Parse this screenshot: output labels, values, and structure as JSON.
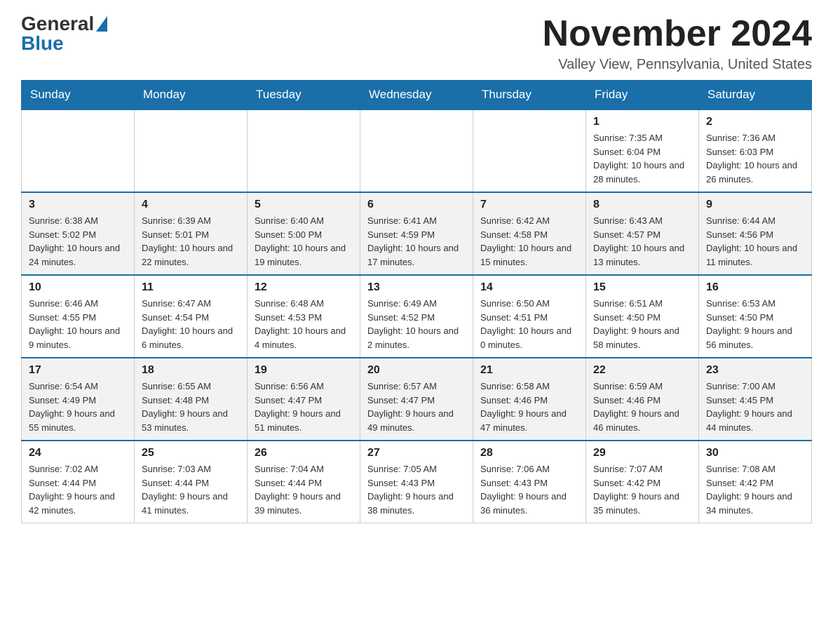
{
  "logo": {
    "general": "General",
    "blue": "Blue"
  },
  "title": "November 2024",
  "subtitle": "Valley View, Pennsylvania, United States",
  "days_of_week": [
    "Sunday",
    "Monday",
    "Tuesday",
    "Wednesday",
    "Thursday",
    "Friday",
    "Saturday"
  ],
  "weeks": [
    [
      {
        "day": "",
        "info": ""
      },
      {
        "day": "",
        "info": ""
      },
      {
        "day": "",
        "info": ""
      },
      {
        "day": "",
        "info": ""
      },
      {
        "day": "",
        "info": ""
      },
      {
        "day": "1",
        "info": "Sunrise: 7:35 AM\nSunset: 6:04 PM\nDaylight: 10 hours and 28 minutes."
      },
      {
        "day": "2",
        "info": "Sunrise: 7:36 AM\nSunset: 6:03 PM\nDaylight: 10 hours and 26 minutes."
      }
    ],
    [
      {
        "day": "3",
        "info": "Sunrise: 6:38 AM\nSunset: 5:02 PM\nDaylight: 10 hours and 24 minutes."
      },
      {
        "day": "4",
        "info": "Sunrise: 6:39 AM\nSunset: 5:01 PM\nDaylight: 10 hours and 22 minutes."
      },
      {
        "day": "5",
        "info": "Sunrise: 6:40 AM\nSunset: 5:00 PM\nDaylight: 10 hours and 19 minutes."
      },
      {
        "day": "6",
        "info": "Sunrise: 6:41 AM\nSunset: 4:59 PM\nDaylight: 10 hours and 17 minutes."
      },
      {
        "day": "7",
        "info": "Sunrise: 6:42 AM\nSunset: 4:58 PM\nDaylight: 10 hours and 15 minutes."
      },
      {
        "day": "8",
        "info": "Sunrise: 6:43 AM\nSunset: 4:57 PM\nDaylight: 10 hours and 13 minutes."
      },
      {
        "day": "9",
        "info": "Sunrise: 6:44 AM\nSunset: 4:56 PM\nDaylight: 10 hours and 11 minutes."
      }
    ],
    [
      {
        "day": "10",
        "info": "Sunrise: 6:46 AM\nSunset: 4:55 PM\nDaylight: 10 hours and 9 minutes."
      },
      {
        "day": "11",
        "info": "Sunrise: 6:47 AM\nSunset: 4:54 PM\nDaylight: 10 hours and 6 minutes."
      },
      {
        "day": "12",
        "info": "Sunrise: 6:48 AM\nSunset: 4:53 PM\nDaylight: 10 hours and 4 minutes."
      },
      {
        "day": "13",
        "info": "Sunrise: 6:49 AM\nSunset: 4:52 PM\nDaylight: 10 hours and 2 minutes."
      },
      {
        "day": "14",
        "info": "Sunrise: 6:50 AM\nSunset: 4:51 PM\nDaylight: 10 hours and 0 minutes."
      },
      {
        "day": "15",
        "info": "Sunrise: 6:51 AM\nSunset: 4:50 PM\nDaylight: 9 hours and 58 minutes."
      },
      {
        "day": "16",
        "info": "Sunrise: 6:53 AM\nSunset: 4:50 PM\nDaylight: 9 hours and 56 minutes."
      }
    ],
    [
      {
        "day": "17",
        "info": "Sunrise: 6:54 AM\nSunset: 4:49 PM\nDaylight: 9 hours and 55 minutes."
      },
      {
        "day": "18",
        "info": "Sunrise: 6:55 AM\nSunset: 4:48 PM\nDaylight: 9 hours and 53 minutes."
      },
      {
        "day": "19",
        "info": "Sunrise: 6:56 AM\nSunset: 4:47 PM\nDaylight: 9 hours and 51 minutes."
      },
      {
        "day": "20",
        "info": "Sunrise: 6:57 AM\nSunset: 4:47 PM\nDaylight: 9 hours and 49 minutes."
      },
      {
        "day": "21",
        "info": "Sunrise: 6:58 AM\nSunset: 4:46 PM\nDaylight: 9 hours and 47 minutes."
      },
      {
        "day": "22",
        "info": "Sunrise: 6:59 AM\nSunset: 4:46 PM\nDaylight: 9 hours and 46 minutes."
      },
      {
        "day": "23",
        "info": "Sunrise: 7:00 AM\nSunset: 4:45 PM\nDaylight: 9 hours and 44 minutes."
      }
    ],
    [
      {
        "day": "24",
        "info": "Sunrise: 7:02 AM\nSunset: 4:44 PM\nDaylight: 9 hours and 42 minutes."
      },
      {
        "day": "25",
        "info": "Sunrise: 7:03 AM\nSunset: 4:44 PM\nDaylight: 9 hours and 41 minutes."
      },
      {
        "day": "26",
        "info": "Sunrise: 7:04 AM\nSunset: 4:44 PM\nDaylight: 9 hours and 39 minutes."
      },
      {
        "day": "27",
        "info": "Sunrise: 7:05 AM\nSunset: 4:43 PM\nDaylight: 9 hours and 38 minutes."
      },
      {
        "day": "28",
        "info": "Sunrise: 7:06 AM\nSunset: 4:43 PM\nDaylight: 9 hours and 36 minutes."
      },
      {
        "day": "29",
        "info": "Sunrise: 7:07 AM\nSunset: 4:42 PM\nDaylight: 9 hours and 35 minutes."
      },
      {
        "day": "30",
        "info": "Sunrise: 7:08 AM\nSunset: 4:42 PM\nDaylight: 9 hours and 34 minutes."
      }
    ]
  ]
}
